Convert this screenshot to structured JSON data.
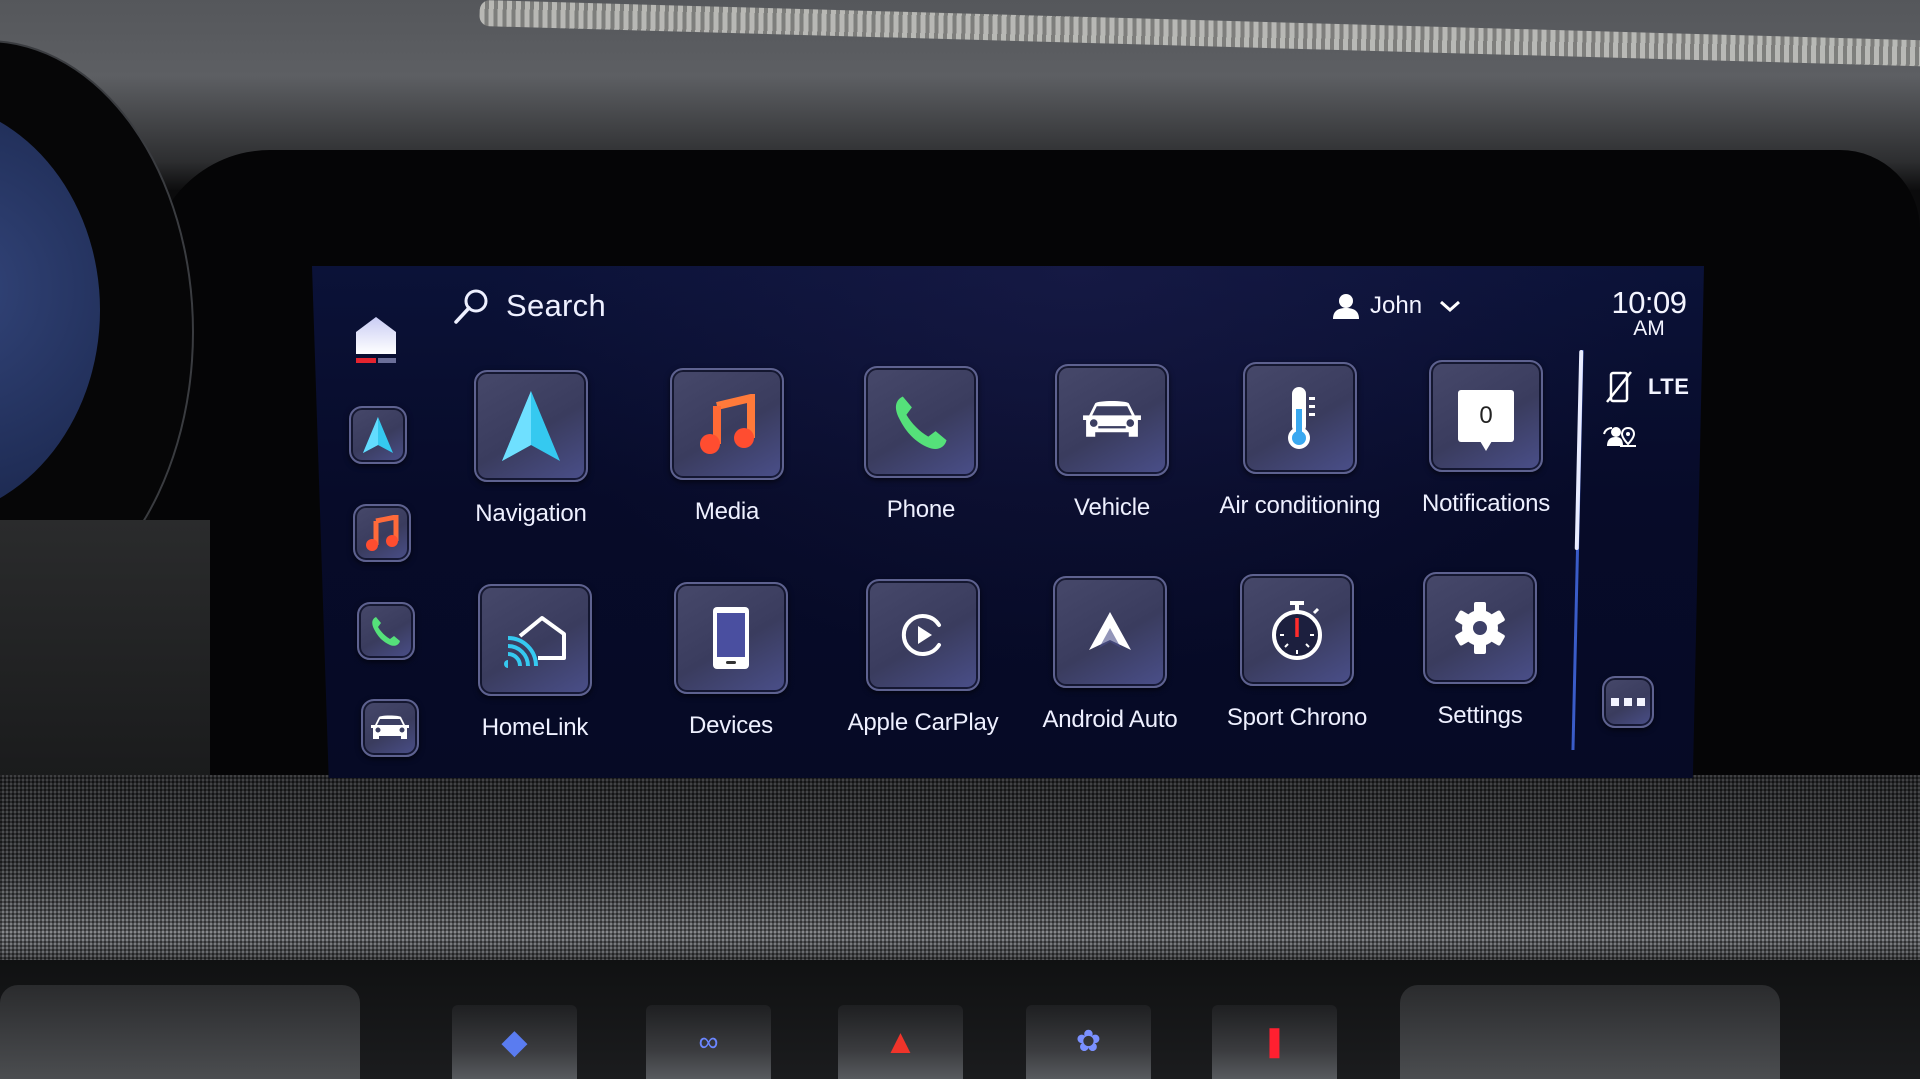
{
  "header": {
    "search_label": "Search",
    "profile_name": "John",
    "time": "10:09",
    "ampm": "AM"
  },
  "sidebar": {
    "items": [
      {
        "name": "home",
        "icon": "home-icon",
        "active": true
      },
      {
        "name": "navigation",
        "icon": "navigation-arrow-icon"
      },
      {
        "name": "media",
        "icon": "music-note-icon"
      },
      {
        "name": "phone",
        "icon": "phone-icon"
      },
      {
        "name": "vehicle",
        "icon": "car-icon"
      }
    ]
  },
  "apps": [
    {
      "label": "Navigation",
      "icon": "navigation-arrow-icon"
    },
    {
      "label": "Media",
      "icon": "music-note-icon"
    },
    {
      "label": "Phone",
      "icon": "phone-icon"
    },
    {
      "label": "Vehicle",
      "icon": "car-icon"
    },
    {
      "label": "Air conditioning",
      "icon": "thermometer-icon"
    },
    {
      "label": "Notifications",
      "icon": "notification-badge-icon",
      "badge_count": "0"
    },
    {
      "label": "HomeLink",
      "icon": "homelink-icon"
    },
    {
      "label": "Devices",
      "icon": "smartphone-icon"
    },
    {
      "label": "Apple CarPlay",
      "icon": "carplay-icon"
    },
    {
      "label": "Android Auto",
      "icon": "android-auto-icon"
    },
    {
      "label": "Sport Chrono",
      "icon": "stopwatch-icon"
    },
    {
      "label": "Settings",
      "icon": "gear-icon"
    }
  ],
  "status": {
    "network": "LTE",
    "phone_connected": false
  },
  "colors": {
    "accent_blue": "#35c9f0",
    "media_orange": "#ff5a3a",
    "phone_green": "#55e07a",
    "home_indicator_red": "#e5242f",
    "screen_bg": "#070b29"
  }
}
